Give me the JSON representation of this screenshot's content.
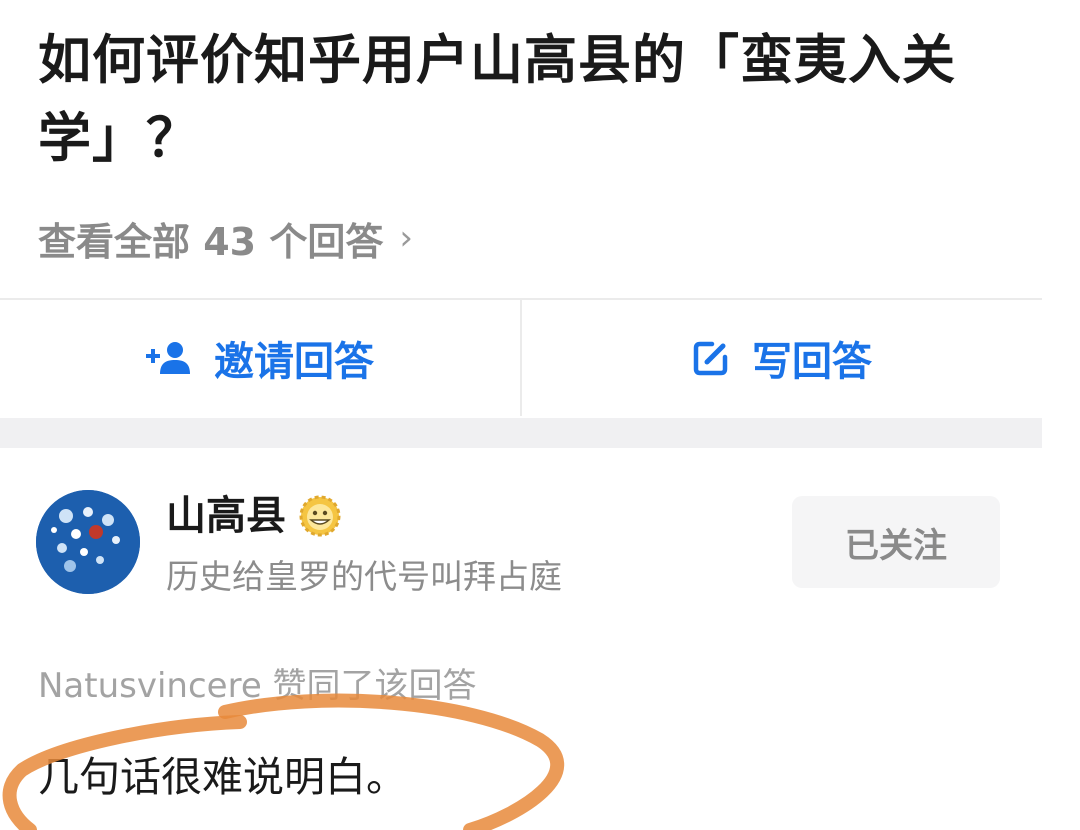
{
  "question": {
    "title": "如何评价知乎用户山高县的「蛮夷入关学」？",
    "view_all": "查看全部 43 个回答",
    "chevron": "›"
  },
  "actions": {
    "invite_label": "邀请回答",
    "invite_icon": "add-person-icon",
    "write_label": "写回答",
    "write_icon": "edit-icon"
  },
  "answer": {
    "author_name": "山高县",
    "author_bio": "历史给皇罗的代号叫拜占庭",
    "follow_label": "已关注",
    "upvote_line": "Natusvincere 赞同了该回答",
    "text": "几句话很难说明白。"
  },
  "colors": {
    "accent": "#1a73e8",
    "annotation": "#e8893b"
  }
}
